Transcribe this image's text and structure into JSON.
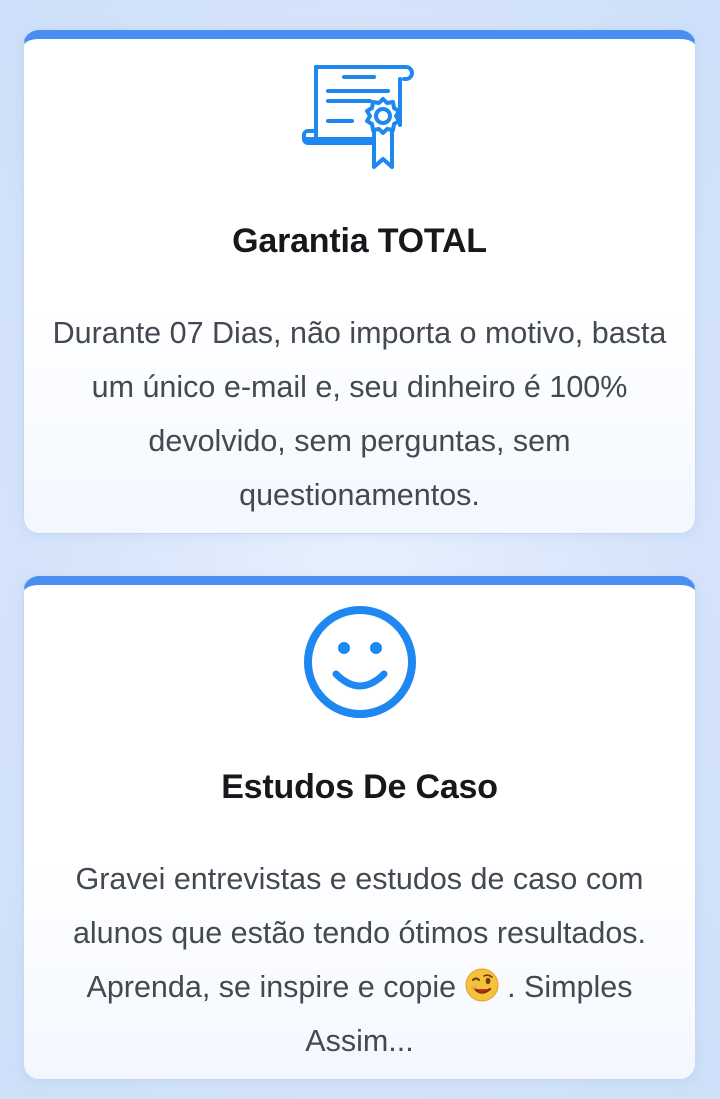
{
  "cards": [
    {
      "icon": "certificate-icon",
      "title": "Garantia TOTAL",
      "text": "Durante 07 Dias, não importa o motivo, basta um único e-mail e, seu dinheiro é 100% devolvido, sem perguntas, sem questionamentos."
    },
    {
      "icon": "smiley-face-icon",
      "title": "Estudos De Caso",
      "text_before_emoji": "Gravei entrevistas e estudos de caso com alunos que estão tendo ótimos resultados. Aprenda, se inspire e copie ",
      "emoji": "winking-face-emoji",
      "text_after_emoji": " . Simples Assim..."
    }
  ],
  "colors": {
    "accent": "#4b8ef1",
    "icon_blue": "#1e88f0",
    "title": "#16181c",
    "body_text": "#444851",
    "background": "#d3e3fb"
  }
}
